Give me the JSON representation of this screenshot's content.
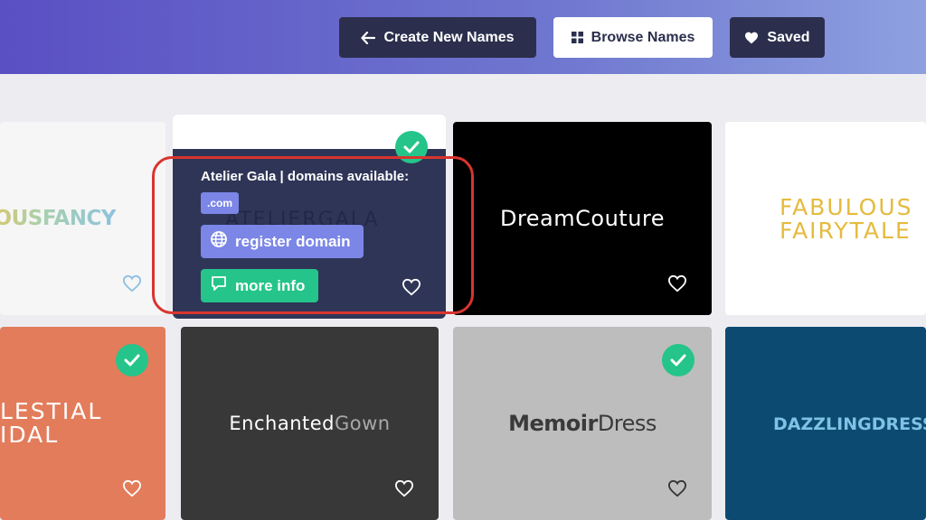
{
  "header": {
    "buttons": {
      "create": "Create New Names",
      "browse": "Browse Names",
      "saved": "Saved"
    }
  },
  "cards": {
    "fabulousfancy": {
      "logo": "ULOUSFANCY",
      "saved": false
    },
    "ateliergala": {
      "overlay_title": "Atelier Gala | domains available:",
      "logo": "ATELIERGALA",
      "tld": ".com",
      "register": "register domain",
      "more_info": "more info",
      "checked": true
    },
    "dreamcouture": {
      "logo": "DreamCouture"
    },
    "fabulousfairytale": {
      "logo_line1": "FABULOUS",
      "logo_line2": "FAIRYTALE"
    },
    "celestialbridal": {
      "logo_line1": "LESTIAL",
      "logo_line2": "IDAL",
      "checked": true
    },
    "enchantedgown": {
      "logo_part1": "Enchanted",
      "logo_part2": "Gown"
    },
    "memoirdress": {
      "logo_part1": "Memoir",
      "logo_part2": "Dress",
      "checked": true
    },
    "dazzlingdress": {
      "logo": "DAZZLINGDRESS"
    }
  },
  "icons": {
    "create": "arrow-left-icon",
    "browse": "grid-icon",
    "saved": "heart-icon",
    "register": "globe-icon",
    "more_info": "chat-icon",
    "save_card": "heart-outline-icon",
    "selected": "check-icon"
  },
  "colors": {
    "header_start": "#5a4fc4",
    "header_end": "#8ea0e0",
    "nav_dark": "#2b2f4d",
    "accent_purple": "#7b86e6",
    "accent_green": "#25c48a",
    "highlight_red": "#d8352f"
  }
}
